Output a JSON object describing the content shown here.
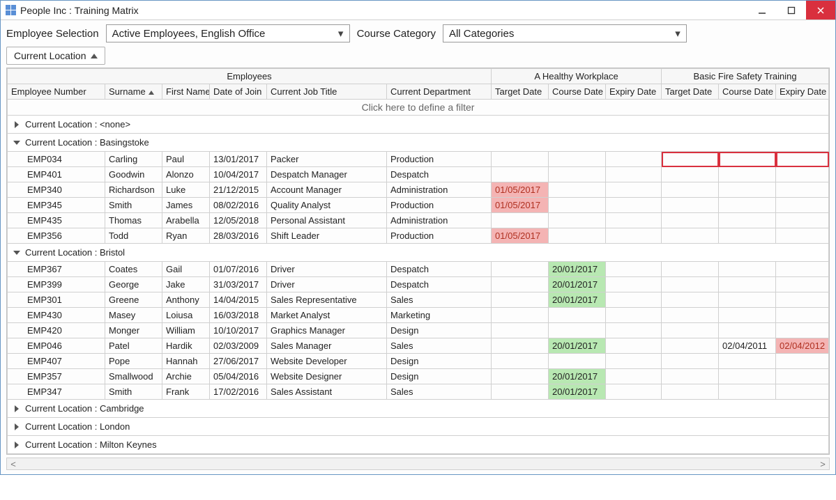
{
  "window_title": "People Inc : Training Matrix",
  "filters": {
    "employee_selection_label": "Employee Selection",
    "employee_selection_value": "Active Employees, English Office",
    "course_category_label": "Course Category",
    "course_category_value": "All Categories"
  },
  "group_chip": "Current Location",
  "bands": {
    "employees": "Employees",
    "course1": "A Healthy Workplace",
    "course2": "Basic Fire Safety Training"
  },
  "columns": {
    "emp_no": "Employee Number",
    "surname": "Surname",
    "first_name": "First Name",
    "date_of_join": "Date of Join",
    "job_title": "Current Job Title",
    "department": "Current Department",
    "target_date": "Target Date",
    "course_date": "Course Date",
    "expiry_date": "Expiry Date"
  },
  "filter_prompt": "Click here to define a filter",
  "group_prefix": "Current Location : ",
  "none_value": "<none>",
  "groups": {
    "basingstoke": "Basingstoke",
    "bristol": "Bristol",
    "cambridge": "Cambridge",
    "london": "London",
    "milton_keynes": "Milton Keynes"
  },
  "rows": {
    "basingstoke": [
      {
        "emp": "EMP034",
        "sn": "Carling",
        "fn": "Paul",
        "doj": "13/01/2017",
        "job": "Packer",
        "dept": "Production",
        "c1t": "",
        "c1c": "",
        "c1e": "",
        "c2t": "",
        "c2c": "",
        "c2e": "",
        "sel2": true
      },
      {
        "emp": "EMP401",
        "sn": "Goodwin",
        "fn": "Alonzo",
        "doj": "10/04/2017",
        "job": "Despatch Manager",
        "dept": "Despatch",
        "c1t": "",
        "c1c": "",
        "c1e": "",
        "c2t": "",
        "c2c": "",
        "c2e": ""
      },
      {
        "emp": "EMP340",
        "sn": "Richardson",
        "fn": "Luke",
        "doj": "21/12/2015",
        "job": "Account Manager",
        "dept": "Administration",
        "c1t": "01/05/2017",
        "c1c": "",
        "c1e": "",
        "c2t": "",
        "c2c": "",
        "c2e": "",
        "c1t_red": true
      },
      {
        "emp": "EMP345",
        "sn": "Smith",
        "fn": "James",
        "doj": "08/02/2016",
        "job": "Quality Analyst",
        "dept": "Production",
        "c1t": "01/05/2017",
        "c1c": "",
        "c1e": "",
        "c2t": "",
        "c2c": "",
        "c2e": "",
        "c1t_red": true
      },
      {
        "emp": "EMP435",
        "sn": "Thomas",
        "fn": "Arabella",
        "doj": "12/05/2018",
        "job": "Personal Assistant",
        "dept": "Administration",
        "c1t": "",
        "c1c": "",
        "c1e": "",
        "c2t": "",
        "c2c": "",
        "c2e": ""
      },
      {
        "emp": "EMP356",
        "sn": "Todd",
        "fn": "Ryan",
        "doj": "28/03/2016",
        "job": "Shift Leader",
        "dept": "Production",
        "c1t": "01/05/2017",
        "c1c": "",
        "c1e": "",
        "c2t": "",
        "c2c": "",
        "c2e": "",
        "c1t_red": true
      }
    ],
    "bristol": [
      {
        "emp": "EMP367",
        "sn": "Coates",
        "fn": "Gail",
        "doj": "01/07/2016",
        "job": "Driver",
        "dept": "Despatch",
        "c1t": "",
        "c1c": "20/01/2017",
        "c1e": "",
        "c2t": "",
        "c2c": "",
        "c2e": "",
        "c1c_green": true
      },
      {
        "emp": "EMP399",
        "sn": "George",
        "fn": "Jake",
        "doj": "31/03/2017",
        "job": "Driver",
        "dept": "Despatch",
        "c1t": "",
        "c1c": "20/01/2017",
        "c1e": "",
        "c2t": "",
        "c2c": "",
        "c2e": "",
        "c1c_green": true
      },
      {
        "emp": "EMP301",
        "sn": "Greene",
        "fn": "Anthony",
        "doj": "14/04/2015",
        "job": "Sales Representative",
        "dept": "Sales",
        "c1t": "",
        "c1c": "20/01/2017",
        "c1e": "",
        "c2t": "",
        "c2c": "",
        "c2e": "",
        "c1c_green": true
      },
      {
        "emp": "EMP430",
        "sn": "Masey",
        "fn": "Loiusa",
        "doj": "16/03/2018",
        "job": "Market Analyst",
        "dept": "Marketing",
        "c1t": "",
        "c1c": "",
        "c1e": "",
        "c2t": "",
        "c2c": "",
        "c2e": ""
      },
      {
        "emp": "EMP420",
        "sn": "Monger",
        "fn": "William",
        "doj": "10/10/2017",
        "job": "Graphics Manager",
        "dept": "Design",
        "c1t": "",
        "c1c": "",
        "c1e": "",
        "c2t": "",
        "c2c": "",
        "c2e": ""
      },
      {
        "emp": "EMP046",
        "sn": "Patel",
        "fn": "Hardik",
        "doj": "02/03/2009",
        "job": "Sales Manager",
        "dept": "Sales",
        "c1t": "",
        "c1c": "20/01/2017",
        "c1e": "",
        "c2t": "",
        "c2c": "02/04/2011",
        "c2e": "02/04/2012",
        "c1c_green": true,
        "c2e_red": true
      },
      {
        "emp": "EMP407",
        "sn": "Pope",
        "fn": "Hannah",
        "doj": "27/06/2017",
        "job": "Website Developer",
        "dept": "Design",
        "c1t": "",
        "c1c": "",
        "c1e": "",
        "c2t": "",
        "c2c": "",
        "c2e": ""
      },
      {
        "emp": "EMP357",
        "sn": "Smallwood",
        "fn": "Archie",
        "doj": "05/04/2016",
        "job": "Website Designer",
        "dept": "Design",
        "c1t": "",
        "c1c": "20/01/2017",
        "c1e": "",
        "c2t": "",
        "c2c": "",
        "c2e": "",
        "c1c_green": true
      },
      {
        "emp": "EMP347",
        "sn": "Smith",
        "fn": "Frank",
        "doj": "17/02/2016",
        "job": "Sales Assistant",
        "dept": "Sales",
        "c1t": "",
        "c1c": "20/01/2017",
        "c1e": "",
        "c2t": "",
        "c2c": "",
        "c2e": "",
        "c1c_green": true
      }
    ]
  }
}
